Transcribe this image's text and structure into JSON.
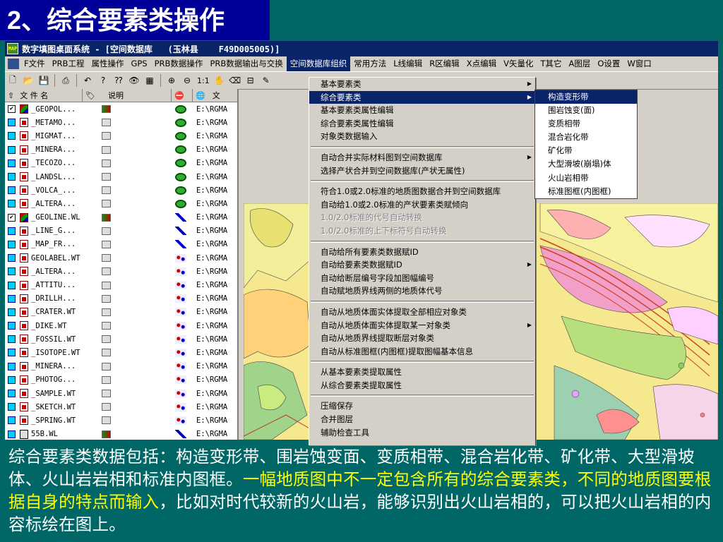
{
  "slide_title": "2、综合要素类操作",
  "window": {
    "title": "数字填图桌面系统 - [空间数据库   (玉林县    F49D005005)]",
    "icon_label": "MAP"
  },
  "menubar": [
    "F文件",
    "PRB工程",
    "属性操作",
    "GPS",
    "PRB数据操作",
    "PRB数据输出与交换",
    "空间数据库组织",
    "常用方法",
    "L线编辑",
    "R区编辑",
    "X点编辑",
    "V矢量化",
    "T其它",
    "A图层",
    "O设置",
    "W窗口"
  ],
  "toolbar": {
    "zoom_label": "1:1"
  },
  "layer_panel": {
    "headers": {
      "file_name": "文 件 名",
      "desc": "说明",
      "path": "文"
    },
    "rows": [
      {
        "name": "_GEOPOL...",
        "checked": true,
        "icon": "multi",
        "lock": "multi",
        "type": "area",
        "path": "E:\\RGMA"
      },
      {
        "name": "_METAMO...",
        "checked": false,
        "icon": "red",
        "lock": "plain",
        "type": "area",
        "path": "E:\\RGMA"
      },
      {
        "name": "_MIGMAT...",
        "checked": false,
        "icon": "red",
        "lock": "plain",
        "type": "area",
        "path": "E:\\RGMA"
      },
      {
        "name": "_MINERA...",
        "checked": false,
        "icon": "red",
        "lock": "plain",
        "type": "area",
        "path": "E:\\RGMA"
      },
      {
        "name": "_TECOZO...",
        "checked": false,
        "icon": "red",
        "lock": "plain",
        "type": "area",
        "path": "E:\\RGMA"
      },
      {
        "name": "_LANDSL...",
        "checked": false,
        "icon": "red",
        "lock": "plain",
        "type": "area",
        "path": "E:\\RGMA"
      },
      {
        "name": "_VOLCA_...",
        "checked": false,
        "icon": "red",
        "lock": "plain",
        "type": "area",
        "path": "E:\\RGMA"
      },
      {
        "name": "_ALTERA...",
        "checked": false,
        "icon": "red",
        "lock": "plain",
        "type": "area",
        "path": "E:\\RGMA"
      },
      {
        "name": "_GEOLINE.WL",
        "checked": true,
        "icon": "multi",
        "lock": "multi",
        "type": "line",
        "path": "E:\\RGMA"
      },
      {
        "name": "_LINE_G...",
        "checked": false,
        "icon": "red",
        "lock": "plain",
        "type": "line",
        "path": "E:\\RGMA"
      },
      {
        "name": "_MAP_FR...",
        "checked": false,
        "icon": "red",
        "lock": "plain",
        "type": "line",
        "path": "E:\\RGMA"
      },
      {
        "name": "GEOLABEL.WT",
        "checked": false,
        "icon": "red",
        "lock": "plain",
        "type": "point",
        "path": "E:\\RGMA"
      },
      {
        "name": "_ALTERA...",
        "checked": false,
        "icon": "red",
        "lock": "plain",
        "type": "point",
        "path": "E:\\RGMA"
      },
      {
        "name": "_ATTITU...",
        "checked": false,
        "icon": "red",
        "lock": "plain",
        "type": "point",
        "path": "E:\\RGMA"
      },
      {
        "name": "_DRILLH...",
        "checked": false,
        "icon": "red",
        "lock": "plain",
        "type": "point",
        "path": "E:\\RGMA"
      },
      {
        "name": "_CRATER.WT",
        "checked": false,
        "icon": "red",
        "lock": "plain",
        "type": "point",
        "path": "E:\\RGMA"
      },
      {
        "name": "_DIKE.WT",
        "checked": false,
        "icon": "red",
        "lock": "plain",
        "type": "point",
        "path": "E:\\RGMA"
      },
      {
        "name": "_FOSSIL.WT",
        "checked": false,
        "icon": "red",
        "lock": "plain",
        "type": "point",
        "path": "E:\\RGMA"
      },
      {
        "name": "_ISOTOPE.WT",
        "checked": false,
        "icon": "red",
        "lock": "plain",
        "type": "point",
        "path": "E:\\RGMA"
      },
      {
        "name": "_MINERA...",
        "checked": false,
        "icon": "red",
        "lock": "plain",
        "type": "point",
        "path": "E:\\RGMA"
      },
      {
        "name": "_PHOTOG...",
        "checked": false,
        "icon": "red",
        "lock": "plain",
        "type": "point",
        "path": "E:\\RGMA"
      },
      {
        "name": "_SAMPLE.WT",
        "checked": false,
        "icon": "red",
        "lock": "plain",
        "type": "point",
        "path": "E:\\RGMA"
      },
      {
        "name": "_SKETCH.WT",
        "checked": false,
        "icon": "red",
        "lock": "plain",
        "type": "point",
        "path": "E:\\RGMA"
      },
      {
        "name": "_SPRING.WT",
        "checked": false,
        "icon": "red",
        "lock": "plain",
        "type": "point",
        "path": "E:\\RGMA"
      },
      {
        "name": "55B.WL",
        "checked": false,
        "icon": "doc",
        "lock": "multi",
        "type": "line",
        "path": "E:\\RGMA"
      }
    ]
  },
  "dropdown": {
    "groups": [
      [
        {
          "label": "基本要素类",
          "arrow": true
        },
        {
          "label": "综合要素类",
          "arrow": true,
          "active": true
        },
        {
          "label": "基本要素类属性编辑"
        },
        {
          "label": "综合要素类属性编辑"
        },
        {
          "label": "对象类数据输入"
        }
      ],
      [
        {
          "label": "自动合并实际材料图到空间数据库",
          "arrow": true
        },
        {
          "label": "选择产状合并到空间数据库(产状无属性)"
        }
      ],
      [
        {
          "label": "符合1.0或2.0标准的地质图数据合并到空间数据库"
        },
        {
          "label": "自动给1.0或2.0标准的产状要素类赋倾向"
        },
        {
          "label": "1.0/2.0标准的代号自动转换",
          "disabled": true
        },
        {
          "label": "1.0/2.0标准的上下标符号自动转换",
          "disabled": true
        }
      ],
      [
        {
          "label": "自动给所有要素类数据赋ID"
        },
        {
          "label": "自动给要素类数据赋ID",
          "arrow": true
        },
        {
          "label": "自动给断层编号字段加图幅编号"
        },
        {
          "label": "自动赋地质界线两侧的地质体代号"
        }
      ],
      [
        {
          "label": "自动从地质体面实体提取全部相应对象类"
        },
        {
          "label": "自动从地质体面实体提取某一对象类",
          "arrow": true
        },
        {
          "label": "自动从地质界线提取断层对象类"
        },
        {
          "label": "自动从标准图框(内图框)提取图幅基本信息"
        }
      ],
      [
        {
          "label": "从基本要素类提取属性"
        },
        {
          "label": "从综合要素类提取属性"
        }
      ],
      [
        {
          "label": "压缩保存"
        },
        {
          "label": "合并图层"
        },
        {
          "label": "辅助检查工具"
        }
      ]
    ]
  },
  "submenu": [
    {
      "label": "构造变形带",
      "active": true
    },
    {
      "label": "围岩蚀变(面)"
    },
    {
      "label": "变质相带"
    },
    {
      "label": "混合岩化带"
    },
    {
      "label": "矿化带"
    },
    {
      "label": "大型滑坡(崩塌)体"
    },
    {
      "label": "火山岩相带"
    },
    {
      "label": "标准图框(内图框)"
    }
  ],
  "caption": {
    "part1": "综合要素类数据包括：构造变形带、围岩蚀变面、变质相带、混合岩化带、矿化带、大型滑坡体、火山岩岩相和标准内图框。",
    "highlight": "一幅地质图中不一定包含所有的综合要素类，不同的地质图要根据自身的特点而输入",
    "part2": "，比如对时代较新的火山岩，能够识别出火山岩相的，可以把火山岩相的内容标绘在图上。"
  },
  "colors": {
    "slide_bg": "#006666",
    "title_bg": "#000099",
    "menu_highlight": "#0a246a",
    "caption_highlight": "#ffff00"
  }
}
